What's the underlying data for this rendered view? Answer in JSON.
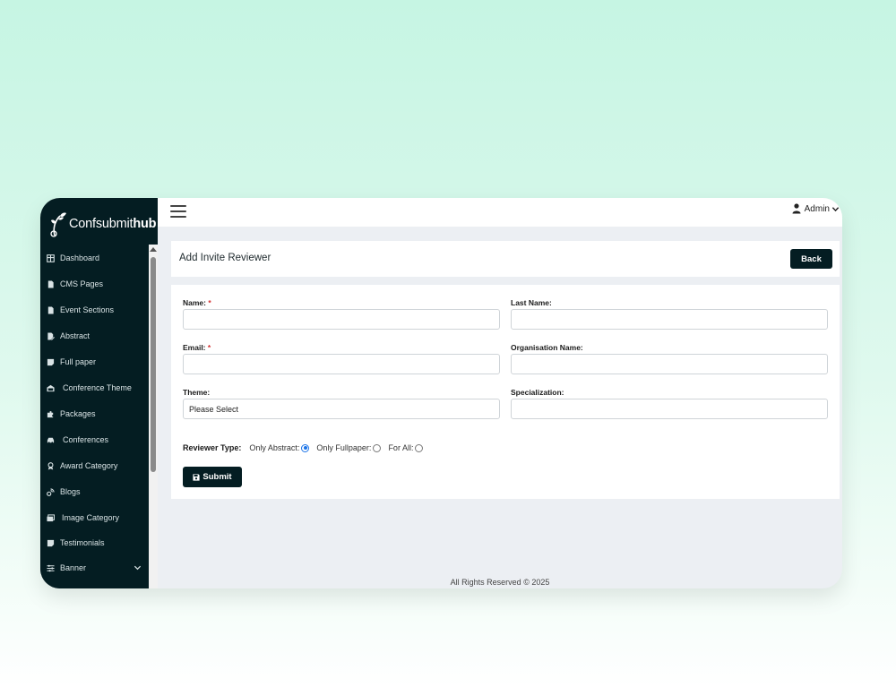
{
  "brand": {
    "name_light": "Confsubmit",
    "name_bold": "hub"
  },
  "sidebar": {
    "items": [
      {
        "label": "Dashboard",
        "icon": "dashboard-icon"
      },
      {
        "label": "CMS Pages",
        "icon": "file-icon"
      },
      {
        "label": "Event Sections",
        "icon": "file-icon"
      },
      {
        "label": "Abstract",
        "icon": "file-pen-icon"
      },
      {
        "label": "Full paper",
        "icon": "note-icon"
      },
      {
        "label": "Conference Theme",
        "icon": "theme-icon"
      },
      {
        "label": "Packages",
        "icon": "puzzle-icon"
      },
      {
        "label": "Conferences",
        "icon": "car-icon"
      },
      {
        "label": "Award Category",
        "icon": "award-icon"
      },
      {
        "label": "Blogs",
        "icon": "blog-icon"
      },
      {
        "label": "Image Category",
        "icon": "images-icon"
      },
      {
        "label": "Testimonials",
        "icon": "note-icon"
      },
      {
        "label": "Banner",
        "icon": "sliders-icon"
      }
    ]
  },
  "topbar": {
    "user_label": "Admin"
  },
  "page": {
    "title": "Add Invite Reviewer",
    "back_label": "Back"
  },
  "form": {
    "name_label": "Name:",
    "last_name_label": "Last Name:",
    "email_label": "Email:",
    "org_label": "Organisation Name:",
    "theme_label": "Theme:",
    "theme_value": "Please Select",
    "spec_label": "Specialization:",
    "required_mark": "*",
    "reviewer_type_label": "Reviewer Type:",
    "reviewer_options": [
      {
        "label": "Only Abstract:",
        "selected": true
      },
      {
        "label": "Only Fullpaper:",
        "selected": false
      },
      {
        "label": "For All:",
        "selected": false
      }
    ],
    "submit_label": "Submit"
  },
  "footer": {
    "text": "All Rights Reserved © 2025"
  },
  "colors": {
    "primary": "#041d22",
    "background": "#eceff3",
    "required": "#d32f2f"
  }
}
